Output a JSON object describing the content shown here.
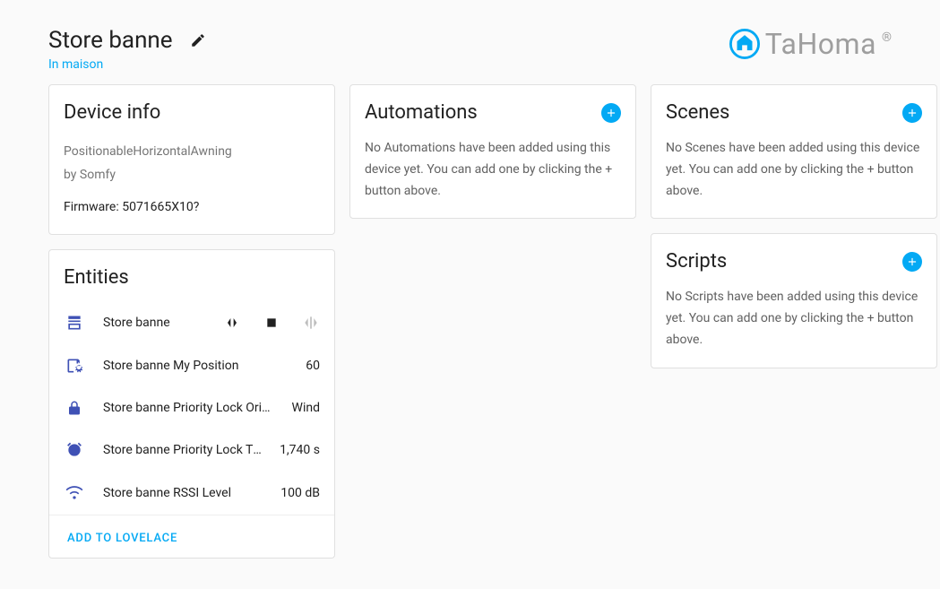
{
  "header": {
    "title": "Store banne",
    "subtitle": "In maison",
    "brand": "TaHoma",
    "brand_reg": "®"
  },
  "device_info": {
    "title": "Device info",
    "model": "PositionableHorizontalAwning",
    "by_prefix": "by ",
    "manufacturer": "Somfy",
    "firmware_label": "Firmware: ",
    "firmware": "5071665X10?"
  },
  "automations": {
    "title": "Automations",
    "empty_text": "No Automations have been added using this device yet. You can add one by clicking the + button above."
  },
  "scenes": {
    "title": "Scenes",
    "empty_text": "No Scenes have been added using this device yet. You can add one by clicking the + button above."
  },
  "scripts": {
    "title": "Scripts",
    "empty_text": "No Scripts have been added using this device yet. You can add one by clicking the + button above."
  },
  "entities": {
    "title": "Entities",
    "add_to_lovelace": "ADD TO LOVELACE",
    "items": [
      {
        "name": "Store banne",
        "value": "",
        "kind": "cover"
      },
      {
        "name": "Store banne My Position",
        "value": "60",
        "kind": "gear"
      },
      {
        "name": "Store banne Priority Lock Origi…",
        "value": "Wind",
        "kind": "lock"
      },
      {
        "name": "Store banne Priority Lock Ti…",
        "value": "1,740 s",
        "kind": "timer"
      },
      {
        "name": "Store banne RSSI Level",
        "value": "100 dB",
        "kind": "wifi"
      }
    ]
  }
}
